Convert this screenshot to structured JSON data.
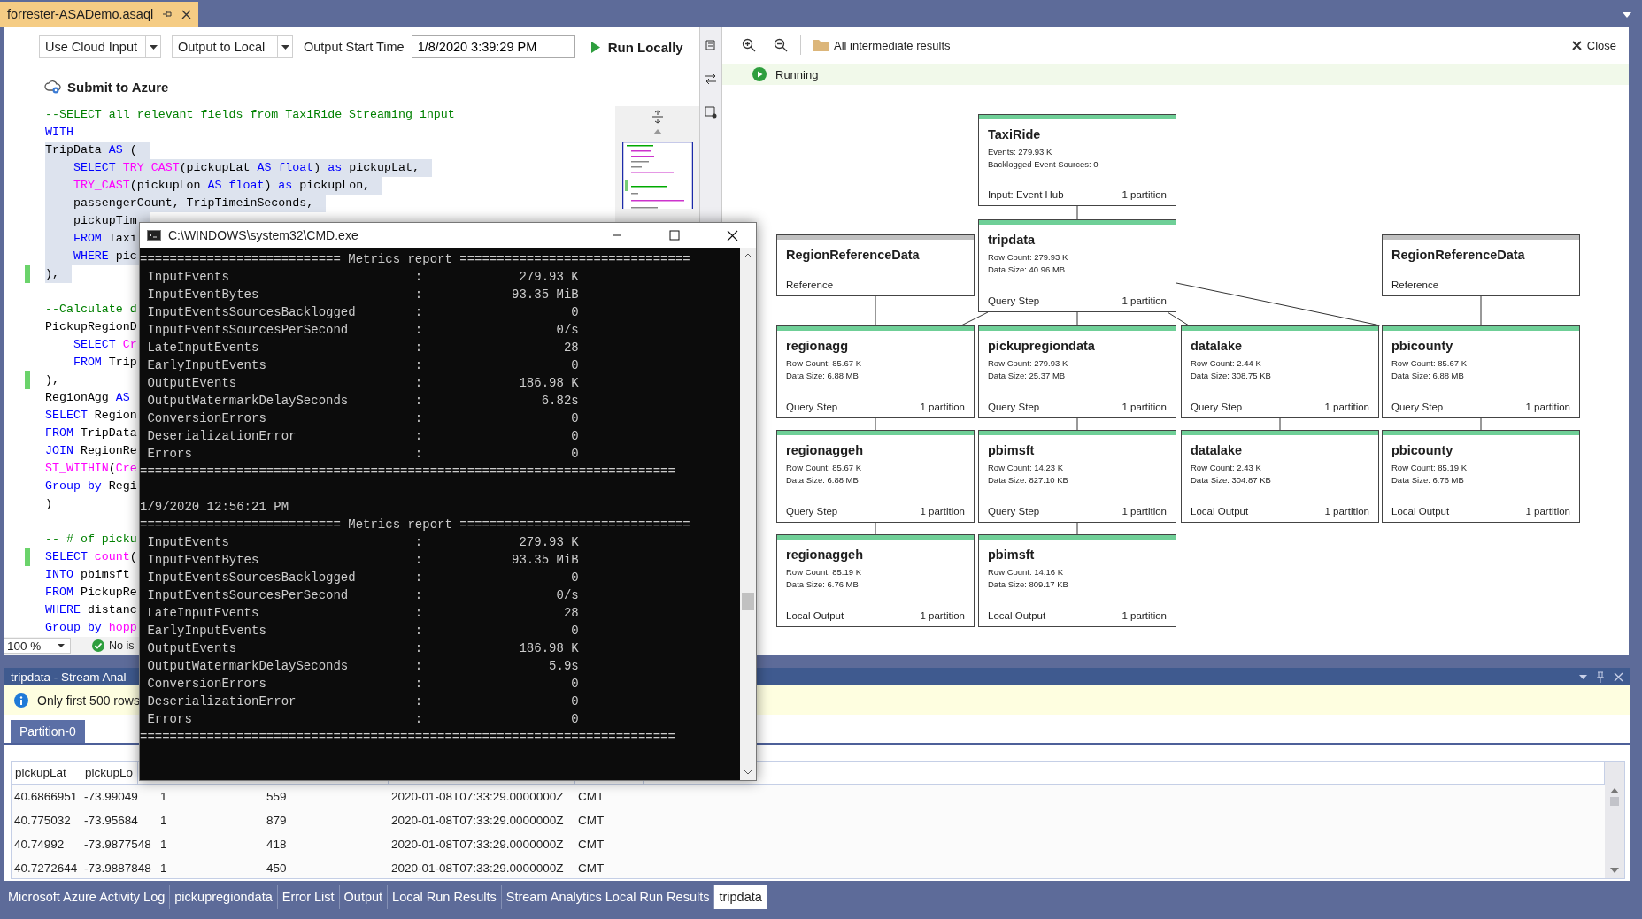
{
  "document_tab": {
    "title": "forrester-ASADemo.asaql",
    "selected": true
  },
  "editor": {
    "input_mode": "Use Cloud Input",
    "output_mode": "Output to Local",
    "start_time_label": "Output Start Time",
    "start_time": "1/8/2020 3:39:29 PM",
    "run": "Run Locally",
    "submit": "Submit to Azure",
    "lines": [
      {
        "kind": "code",
        "highlighted": false,
        "modified": false,
        "tokens": [
          {
            "kind": "comment",
            "text": "--SELECT all relevant fields from TaxiRide Streaming input"
          }
        ]
      },
      {
        "kind": "code",
        "highlighted": false,
        "modified": false,
        "tokens": [
          {
            "kind": "keyword",
            "text": "WITH"
          }
        ]
      },
      {
        "kind": "code",
        "highlighted": true,
        "modified": false,
        "tokens": [
          {
            "kind": "plain",
            "text": "TripData "
          },
          {
            "kind": "keyword",
            "text": "AS"
          },
          {
            "kind": "plain",
            "text": " ("
          }
        ]
      },
      {
        "kind": "code",
        "highlighted": true,
        "modified": false,
        "tokens": [
          {
            "kind": "keyword",
            "text": "    SELECT "
          },
          {
            "kind": "function",
            "text": "TRY_CAST"
          },
          {
            "kind": "plain",
            "text": "(pickupLat "
          },
          {
            "kind": "keyword",
            "text": "AS float"
          },
          {
            "kind": "plain",
            "text": ") "
          },
          {
            "kind": "keyword",
            "text": "as"
          },
          {
            "kind": "plain",
            "text": " pickupLat,"
          }
        ]
      },
      {
        "kind": "code",
        "highlighted": true,
        "modified": false,
        "tokens": [
          {
            "kind": "function",
            "text": "    TRY_CAST"
          },
          {
            "kind": "plain",
            "text": "(pickupLon "
          },
          {
            "kind": "keyword",
            "text": "AS float"
          },
          {
            "kind": "plain",
            "text": ") "
          },
          {
            "kind": "keyword",
            "text": "as"
          },
          {
            "kind": "plain",
            "text": " pickupLon,"
          }
        ]
      },
      {
        "kind": "code",
        "highlighted": true,
        "modified": false,
        "tokens": [
          {
            "kind": "plain",
            "text": "    passengerCount, TripTimeinSeconds,"
          }
        ]
      },
      {
        "kind": "code",
        "highlighted": true,
        "modified": false,
        "tokens": [
          {
            "kind": "plain",
            "text": "    pickupTim"
          }
        ]
      },
      {
        "kind": "code",
        "highlighted": true,
        "modified": false,
        "tokens": [
          {
            "kind": "keyword",
            "text": "    FROM"
          },
          {
            "kind": "plain",
            "text": " Taxi"
          }
        ]
      },
      {
        "kind": "code",
        "highlighted": true,
        "modified": false,
        "tokens": [
          {
            "kind": "keyword",
            "text": "    WHERE"
          },
          {
            "kind": "plain",
            "text": " pic"
          }
        ]
      },
      {
        "kind": "code",
        "highlighted": true,
        "modified": true,
        "tokens": [
          {
            "kind": "plain",
            "text": "),"
          }
        ]
      },
      {
        "kind": "blank"
      },
      {
        "kind": "code",
        "highlighted": false,
        "modified": false,
        "tokens": [
          {
            "kind": "comment",
            "text": "--Calculate d"
          }
        ]
      },
      {
        "kind": "code",
        "highlighted": false,
        "modified": false,
        "tokens": [
          {
            "kind": "plain",
            "text": "PickupRegionD"
          }
        ]
      },
      {
        "kind": "code",
        "highlighted": false,
        "modified": false,
        "tokens": [
          {
            "kind": "keyword",
            "text": "    SELECT "
          },
          {
            "kind": "function",
            "text": "Cr"
          }
        ]
      },
      {
        "kind": "code",
        "highlighted": false,
        "modified": false,
        "tokens": [
          {
            "kind": "keyword",
            "text": "    FROM"
          },
          {
            "kind": "plain",
            "text": " Trip"
          }
        ]
      },
      {
        "kind": "code",
        "highlighted": false,
        "modified": true,
        "tokens": [
          {
            "kind": "plain",
            "text": "),"
          }
        ]
      },
      {
        "kind": "code",
        "highlighted": false,
        "modified": false,
        "tokens": [
          {
            "kind": "plain",
            "text": "RegionAgg "
          },
          {
            "kind": "keyword",
            "text": "AS"
          }
        ]
      },
      {
        "kind": "code",
        "highlighted": false,
        "modified": false,
        "tokens": [
          {
            "kind": "keyword",
            "text": "SELECT"
          },
          {
            "kind": "plain",
            "text": " Region"
          }
        ]
      },
      {
        "kind": "code",
        "highlighted": false,
        "modified": false,
        "tokens": [
          {
            "kind": "keyword",
            "text": "FROM"
          },
          {
            "kind": "plain",
            "text": " TripData"
          }
        ]
      },
      {
        "kind": "code",
        "highlighted": false,
        "modified": false,
        "tokens": [
          {
            "kind": "keyword",
            "text": "JOIN"
          },
          {
            "kind": "plain",
            "text": " RegionRe"
          }
        ]
      },
      {
        "kind": "code",
        "highlighted": false,
        "modified": false,
        "tokens": [
          {
            "kind": "function",
            "text": "ST_WITHIN"
          },
          {
            "kind": "plain",
            "text": "("
          },
          {
            "kind": "function",
            "text": "Cre"
          }
        ]
      },
      {
        "kind": "code",
        "highlighted": false,
        "modified": false,
        "tokens": [
          {
            "kind": "keyword",
            "text": "Group by"
          },
          {
            "kind": "plain",
            "text": " Regi"
          }
        ]
      },
      {
        "kind": "code",
        "highlighted": false,
        "modified": false,
        "tokens": [
          {
            "kind": "plain",
            "text": ")"
          }
        ]
      },
      {
        "kind": "blank"
      },
      {
        "kind": "code",
        "highlighted": false,
        "modified": false,
        "tokens": [
          {
            "kind": "comment",
            "text": "-- # of picku"
          }
        ]
      },
      {
        "kind": "code",
        "highlighted": false,
        "modified": true,
        "tokens": [
          {
            "kind": "keyword",
            "text": "SELECT "
          },
          {
            "kind": "function",
            "text": "count"
          },
          {
            "kind": "plain",
            "text": "("
          }
        ]
      },
      {
        "kind": "code",
        "highlighted": false,
        "modified": false,
        "tokens": [
          {
            "kind": "keyword",
            "text": "INTO"
          },
          {
            "kind": "plain",
            "text": " pbimsft"
          }
        ]
      },
      {
        "kind": "code",
        "highlighted": false,
        "modified": false,
        "tokens": [
          {
            "kind": "keyword",
            "text": "FROM"
          },
          {
            "kind": "plain",
            "text": " PickupRe"
          }
        ]
      },
      {
        "kind": "code",
        "highlighted": false,
        "modified": false,
        "tokens": [
          {
            "kind": "keyword",
            "text": "WHERE"
          },
          {
            "kind": "plain",
            "text": " distanc"
          }
        ]
      },
      {
        "kind": "code",
        "highlighted": false,
        "modified": false,
        "tokens": [
          {
            "kind": "keyword",
            "text": "Group by "
          },
          {
            "kind": "function",
            "text": "hopp"
          }
        ]
      }
    ],
    "zoom": "100 %",
    "issues": "No is"
  },
  "diagram": {
    "results": "All intermediate results",
    "close": "Close",
    "status": "Running",
    "nodes": [
      {
        "title": "TaxiRide",
        "stats": [
          "Events: 279.93 K",
          "Backlogged Event Sources: 0"
        ],
        "type": "Input: Event Hub",
        "partitions": "1 partition",
        "color": "#6fcf97"
      },
      {
        "title": "RegionReferenceData",
        "type": "Reference",
        "color": "#c0c0c0"
      },
      {
        "title": "tripdata",
        "stats": [
          "Row Count: 279.93 K",
          "Data Size: 40.96 MB"
        ],
        "type": "Query Step",
        "partitions": "1 partition",
        "color": "#6fcf97"
      },
      {
        "title": "RegionReferenceData",
        "type": "Reference",
        "color": "#c0c0c0"
      },
      {
        "title": "regionagg",
        "stats": [
          "Row Count: 85.67 K",
          "Data Size: 6.88 MB"
        ],
        "type": "Query Step",
        "partitions": "1 partition",
        "color": "#6fcf97"
      },
      {
        "title": "pickupregiondata",
        "stats": [
          "Row Count: 279.93 K",
          "Data Size: 25.37 MB"
        ],
        "type": "Query Step",
        "partitions": "1 partition",
        "color": "#6fcf97"
      },
      {
        "title": "datalake",
        "stats": [
          "Row Count: 2.44 K",
          "Data Size: 308.75 KB"
        ],
        "type": "Query Step",
        "partitions": "1 partition",
        "color": "#6fcf97"
      },
      {
        "title": "pbicounty",
        "stats": [
          "Row Count: 85.67 K",
          "Data Size: 6.88 MB"
        ],
        "type": "Query Step",
        "partitions": "1 partition",
        "color": "#6fcf97"
      },
      {
        "title": "regionaggeh",
        "stats": [
          "Row Count: 85.67 K",
          "Data Size: 6.88 MB"
        ],
        "type": "Query Step",
        "partitions": "1 partition",
        "color": "#6fcf97"
      },
      {
        "title": "pbimsft",
        "stats": [
          "Row Count: 14.23 K",
          "Data Size: 827.10 KB"
        ],
        "type": "Query Step",
        "partitions": "1 partition",
        "color": "#6fcf97"
      },
      {
        "title": "datalake",
        "stats": [
          "Row Count: 2.43 K",
          "Data Size: 304.87 KB"
        ],
        "type": "Local Output",
        "partitions": "1 partition",
        "color": "#6fcf97"
      },
      {
        "title": "pbicounty",
        "stats": [
          "Row Count: 85.19 K",
          "Data Size: 6.76 MB"
        ],
        "type": "Local Output",
        "partitions": "1 partition",
        "color": "#6fcf97"
      },
      {
        "title": "regionaggeh",
        "stats": [
          "Row Count: 85.19 K",
          "Data Size: 6.76 MB"
        ],
        "type": "Local Output",
        "partitions": "1 partition",
        "color": "#6fcf97"
      },
      {
        "title": "pbimsft",
        "stats": [
          "Row Count: 14.16 K",
          "Data Size: 809.17 KB"
        ],
        "type": "Local Output",
        "partitions": "1 partition",
        "color": "#6fcf97"
      }
    ]
  },
  "results_panel": {
    "title": "tripdata - Stream Anal",
    "notice": "Only first 500 rows",
    "tabs": [
      {
        "label": "Partition-0",
        "selected": true
      }
    ],
    "columns": [
      "pickupLat",
      "pickupLo"
    ],
    "rows": [
      [
        "40.6866951",
        "-73.99049",
        "1",
        "559",
        "2020-01-08T07:33:29.0000000Z",
        "CMT"
      ],
      [
        "40.775032",
        "-73.95684",
        "1",
        "879",
        "2020-01-08T07:33:29.0000000Z",
        "CMT"
      ],
      [
        "40.74992",
        "-73.9877548",
        "1",
        "418",
        "2020-01-08T07:33:29.0000000Z",
        "CMT"
      ],
      [
        "40.7272644",
        "-73.9887848",
        "1",
        "450",
        "2020-01-08T07:33:29.0000000Z",
        "CMT"
      ]
    ]
  },
  "bottom_tabs": [
    {
      "label": "Microsoft Azure Activity Log",
      "selected": false
    },
    {
      "label": "pickupregiondata",
      "selected": false
    },
    {
      "label": "Error List",
      "selected": false
    },
    {
      "label": "Output",
      "selected": false
    },
    {
      "label": "Local Run Results",
      "selected": false
    },
    {
      "label": "Stream Analytics Local Run Results",
      "selected": false
    },
    {
      "label": "tripdata",
      "selected": true
    }
  ],
  "console": {
    "title": "C:\\WINDOWS\\system32\\CMD.exe",
    "blocks": [
      {
        "header": "=========================== Metrics report ===============================",
        "metrics": [
          {
            "name": "InputEvents",
            "sep": ":",
            "value": "279.93 K"
          },
          {
            "name": "InputEventBytes",
            "sep": ":",
            "value": "93.35 MiB"
          },
          {
            "name": "InputEventsSourcesBacklogged",
            "sep": ":",
            "value": "0"
          },
          {
            "name": "InputEventsSourcesPerSecond",
            "sep": ":",
            "value": "0/s"
          },
          {
            "name": "LateInputEvents",
            "sep": ":",
            "value": "28"
          },
          {
            "name": "EarlyInputEvents",
            "sep": ":",
            "value": "0"
          },
          {
            "name": "OutputEvents",
            "sep": ":",
            "value": "186.98 K"
          },
          {
            "name": "OutputWatermarkDelaySeconds",
            "sep": ":",
            "value": "6.82s"
          },
          {
            "name": "ConversionErrors",
            "sep": ":",
            "value": "0"
          },
          {
            "name": "DeserializationError",
            "sep": ":",
            "value": "0"
          },
          {
            "name": "Errors",
            "sep": ":",
            "value": "0"
          }
        ],
        "footer": "========================================================================"
      },
      {
        "timestamp": "1/9/2020 12:56:21 PM",
        "header": "=========================== Metrics report ===============================",
        "metrics": [
          {
            "name": "InputEvents",
            "sep": ":",
            "value": "279.93 K"
          },
          {
            "name": "InputEventBytes",
            "sep": ":",
            "value": "93.35 MiB"
          },
          {
            "name": "InputEventsSourcesBacklogged",
            "sep": ":",
            "value": "0"
          },
          {
            "name": "InputEventsSourcesPerSecond",
            "sep": ":",
            "value": "0/s"
          },
          {
            "name": "LateInputEvents",
            "sep": ":",
            "value": "28"
          },
          {
            "name": "EarlyInputEvents",
            "sep": ":",
            "value": "0"
          },
          {
            "name": "OutputEvents",
            "sep": ":",
            "value": "186.98 K"
          },
          {
            "name": "OutputWatermarkDelaySeconds",
            "sep": ":",
            "value": "5.9s"
          },
          {
            "name": "ConversionErrors",
            "sep": ":",
            "value": "0"
          },
          {
            "name": "DeserializationError",
            "sep": ":",
            "value": "0"
          },
          {
            "name": "Errors",
            "sep": ":",
            "value": "0"
          }
        ],
        "footer": "========================================================================"
      }
    ]
  }
}
